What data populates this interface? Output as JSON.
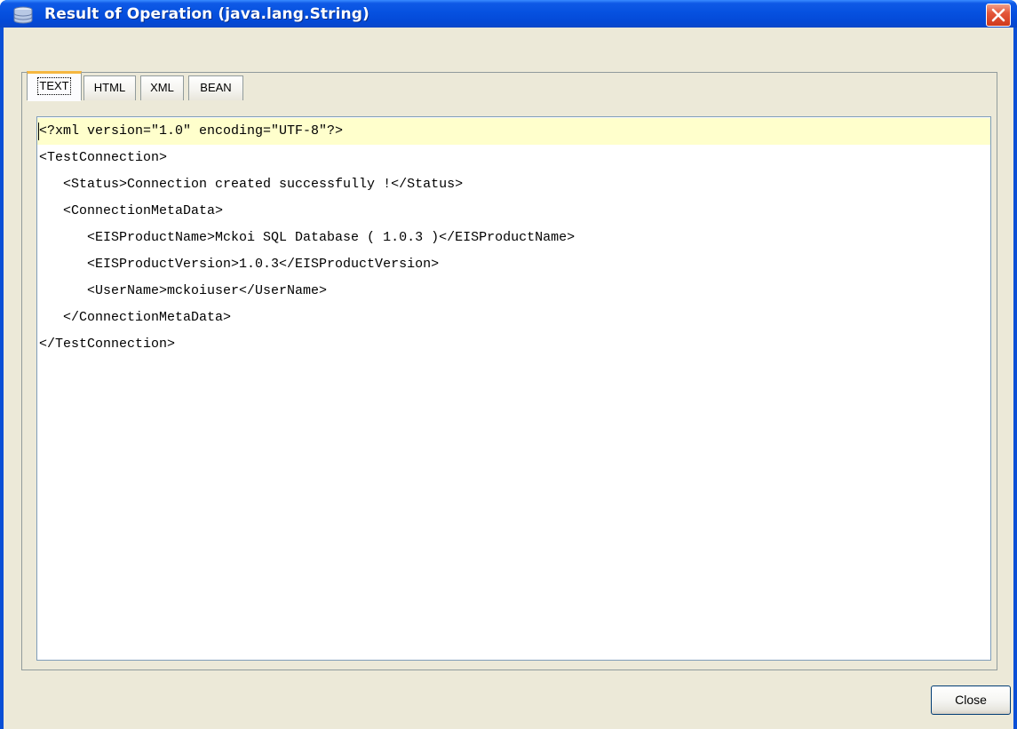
{
  "window": {
    "title": "Result of Operation (java.lang.String)",
    "title_icon": "database-icon",
    "close_icon": "close-icon"
  },
  "tabs": [
    {
      "label": "TEXT",
      "active": true
    },
    {
      "label": "HTML",
      "active": false
    },
    {
      "label": "XML",
      "active": false
    },
    {
      "label": "BEAN",
      "active": false
    }
  ],
  "content": {
    "lines": [
      "<?xml version=\"1.0\" encoding=\"UTF-8\"?>",
      "<TestConnection>",
      "   <Status>Connection created successfully !</Status>",
      "   <ConnectionMetaData>",
      "      <EISProductName>Mckoi SQL Database ( 1.0.3 )</EISProductName>",
      "      <EISProductVersion>1.0.3</EISProductVersion>",
      "      <UserName>mckoiuser</UserName>",
      "   </ConnectionMetaData>",
      "</TestConnection>"
    ]
  },
  "footer": {
    "close_label": "Close"
  },
  "colors": {
    "titlebar": "#0651e0",
    "dialog_bg": "#ece9d8",
    "current_line": "#ffffcc",
    "active_tab_accent": "#f5b740"
  }
}
